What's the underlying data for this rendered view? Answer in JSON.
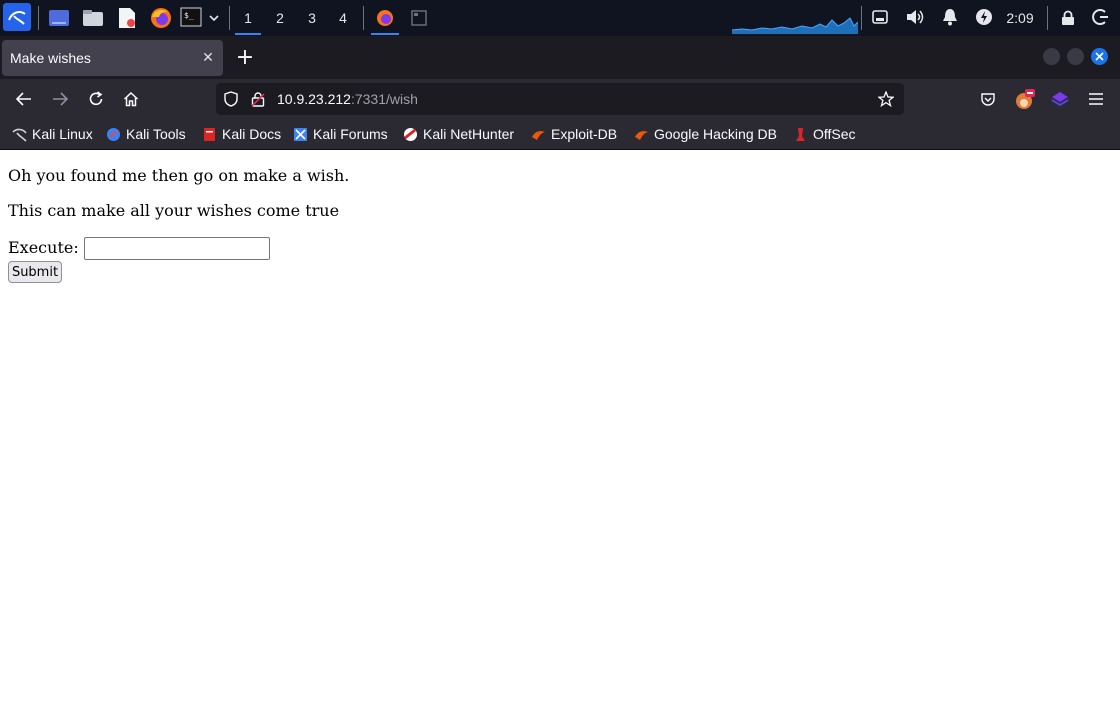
{
  "panel": {
    "workspaces": [
      "1",
      "2",
      "3",
      "4"
    ],
    "active_workspace": "1",
    "clock": "2:09",
    "accent_color": "#3b82f6"
  },
  "tabs": {
    "active_title": "Make wishes"
  },
  "navbar": {
    "url_host": "10.9.23.212",
    "url_rest": ":7331/wish"
  },
  "bookmarks": [
    {
      "label": "Kali Linux",
      "icon": "kali-dragon-icon"
    },
    {
      "label": "Kali Tools",
      "icon": "kali-tools-icon"
    },
    {
      "label": "Kali Docs",
      "icon": "kali-docs-icon"
    },
    {
      "label": "Kali Forums",
      "icon": "kali-forums-icon"
    },
    {
      "label": "Kali NetHunter",
      "icon": "nethunter-icon"
    },
    {
      "label": "Exploit-DB",
      "icon": "exploit-db-icon"
    },
    {
      "label": "Google Hacking DB",
      "icon": "ghdb-icon"
    },
    {
      "label": "OffSec",
      "icon": "offsec-icon"
    }
  ],
  "page": {
    "line1": "Oh you found me then go on make a wish.",
    "line2": "This can make all your wishes come true",
    "execute_label": "Execute:",
    "execute_value": "",
    "submit_label": "Submit"
  }
}
